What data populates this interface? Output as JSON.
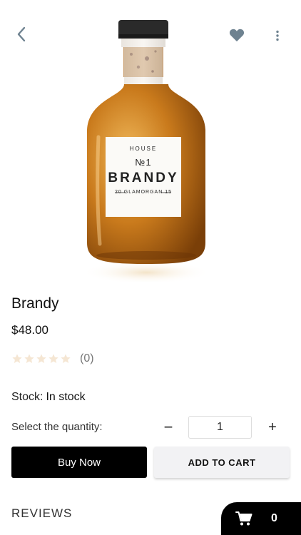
{
  "colors": {
    "icon_gray": "#6e8290",
    "primary_button": "#000000",
    "secondary_button": "#f2f2f4",
    "star_empty": "#f5e6d3"
  },
  "header": {
    "back_icon": "chevron-left-icon",
    "favorite_icon": "heart-icon",
    "more_icon": "more-vertical-icon"
  },
  "product_image": {
    "label": {
      "line1": "HOUSE",
      "line2": "№1",
      "line3": "BRANDY",
      "line4": "20 GLAMORGAN 15"
    }
  },
  "product": {
    "name": "Brandy",
    "price": "$48.00",
    "rating": {
      "stars": 0,
      "max": 5,
      "count_text": "(0)"
    }
  },
  "stock": {
    "label": "Stock:",
    "value": "In stock"
  },
  "quantity": {
    "label": "Select the quantity:",
    "minus": "−",
    "value": "1",
    "plus": "+"
  },
  "actions": {
    "buy_now": "Buy Now",
    "add_to_cart": "ADD TO CART"
  },
  "reviews": {
    "heading": "REVIEWS"
  },
  "cart": {
    "icon": "shopping-cart-icon",
    "count": "0"
  }
}
